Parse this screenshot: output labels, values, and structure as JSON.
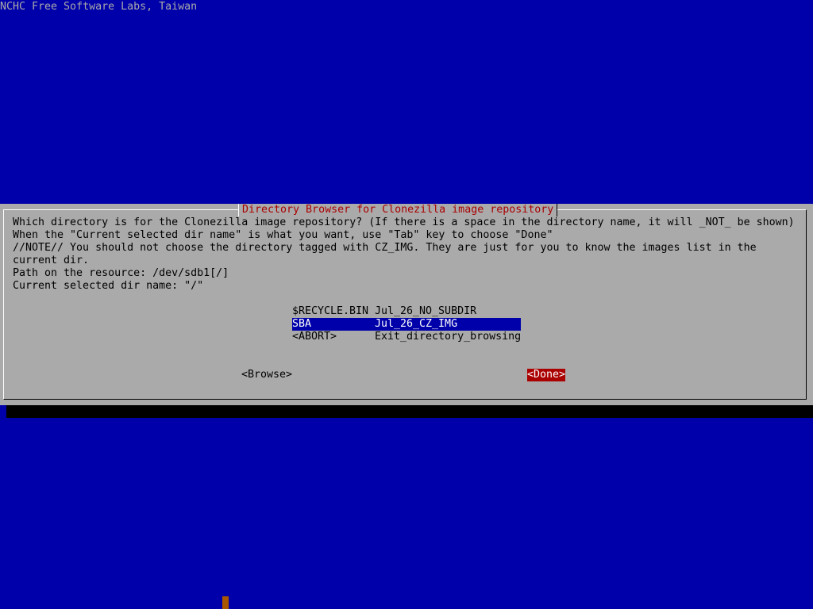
{
  "backtitle": "NCHC Free Software Labs, Taiwan",
  "dialog": {
    "title": "Directory Browser for Clonezilla image repository",
    "message_lines": [
      "Which directory is for the Clonezilla image repository? (If there is a space in the directory name, it will _NOT_ be shown)",
      "When the \"Current selected dir name\" is what you want, use \"Tab\" key to choose \"Done\"",
      "//NOTE// You should not choose the directory tagged with CZ_IMG. They are just for you to know the images list in the",
      "current dir.",
      "Path on the resource: /dev/sdb1[/]",
      "Current selected dir name: \"/\""
    ],
    "menu": [
      {
        "tag": "$RECYCLE.BIN",
        "desc": "Jul_26_NO_SUBDIR",
        "selected": false
      },
      {
        "tag": "SBA",
        "desc": "Jul_26_CZ_IMG",
        "selected": true
      },
      {
        "tag": "<ABORT>",
        "desc": "Exit_directory_browsing",
        "selected": false
      }
    ],
    "buttons": {
      "browse": "<Browse>",
      "done": "<Done>"
    }
  },
  "colors": {
    "background": "#0000aa",
    "dialog": "#aaaaaa",
    "title": "#aa0000",
    "selection": "#0000aa",
    "active_button": "#aa0000"
  }
}
